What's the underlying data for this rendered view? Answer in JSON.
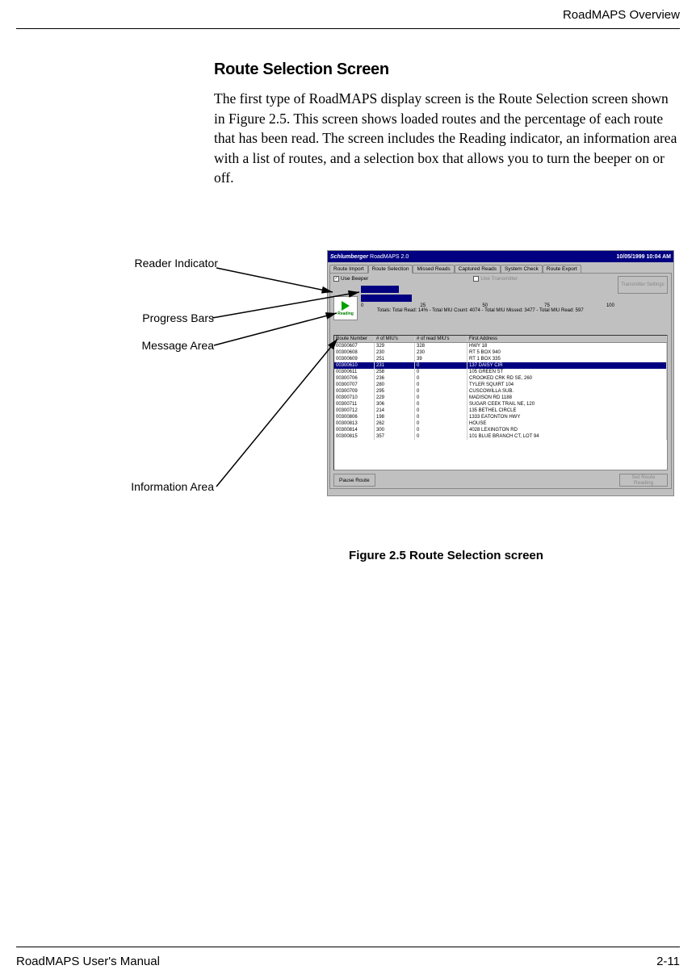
{
  "header": {
    "right": "RoadMAPS Overview"
  },
  "section": {
    "title": "Route Selection Screen",
    "body": "The first type of RoadMAPS display screen is the Route Selection screen shown in Figure 2.5. This screen shows loaded routes and the percentage of each route that has been read. The screen includes the Reading indicator, an information area with a list of routes, and a selection box that allows you to turn the beeper on or off."
  },
  "callouts": {
    "reader": "Reader Indicator",
    "progress": "Progress Bars",
    "message": "Message Area",
    "info": "Information Area"
  },
  "screenshot": {
    "brand": "Schlumberger",
    "appname": "RoadMAPS 2.0",
    "datetime": "10/05/1999 10:04 AM",
    "tabs": [
      "Route Import",
      "Route Selection",
      "Missed Reads",
      "Captured Reads",
      "System Check",
      "Route Export"
    ],
    "active_tab": "Route Selection",
    "use_beeper": "Use Beeper",
    "use_transmitter": "Use Transmitter",
    "transmitter_btn": "Transmitter Settings",
    "reading_label": "Reading",
    "ruler": [
      "0",
      "25",
      "50",
      "75",
      "100"
    ],
    "totals": "Totals:    Total Read: 14%  -  Total MIU Count: 4074  -  Total MIU Missed: 3477  -  Total MIU Read: 597",
    "headers": [
      "Route Number",
      "# of MIU's",
      "# of read MIU's",
      "First Address"
    ],
    "rows": [
      [
        "00300607",
        "329",
        "328",
        "HWY 18"
      ],
      [
        "00300608",
        "230",
        "230",
        "RT 5 BOX 940"
      ],
      [
        "00300609",
        "251",
        "39",
        "RT 1 BOX 335"
      ],
      [
        "00300610",
        "231",
        "0",
        "137 DAISY CIR"
      ],
      [
        "00300611",
        "258",
        "0",
        "105 GREEN ST"
      ],
      [
        "00300706",
        "236",
        "0",
        "CROOKED CRK RD SE, 260"
      ],
      [
        "00300707",
        "280",
        "0",
        "TYLER SQUIRT 104"
      ],
      [
        "00300709",
        "295",
        "0",
        "CUSCOWILLA SUB."
      ],
      [
        "00300710",
        "229",
        "0",
        "MADISON RD 1188"
      ],
      [
        "00300711",
        "306",
        "0",
        "SUGAR CEEK TRAIL NE, 120"
      ],
      [
        "00300712",
        "214",
        "0",
        "135 BETHEL CIRCLE"
      ],
      [
        "00300806",
        "198",
        "0",
        "1333 EATONTON HWY"
      ],
      [
        "00300813",
        "262",
        "0",
        "HOUSE"
      ],
      [
        "00300814",
        "300",
        "0",
        "4028 LEXINGTON RD"
      ],
      [
        "00300815",
        "357",
        "0",
        "101 BLUE BRANCH CT, LOT 94"
      ]
    ],
    "pause_btn": "Pause Route",
    "set_route_btn": "Set Route Reading"
  },
  "figure": {
    "caption": "Figure 2.5   Route Selection screen"
  },
  "footer": {
    "left": "RoadMAPS User's Manual",
    "right": "2-11"
  }
}
